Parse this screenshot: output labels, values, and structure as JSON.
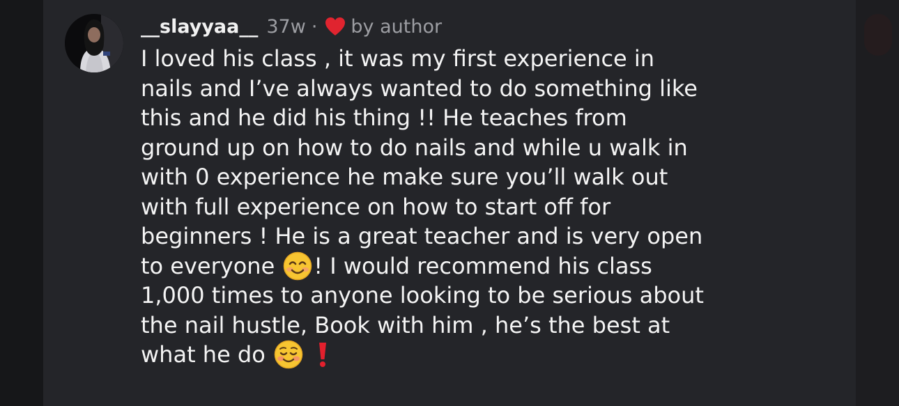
{
  "comment": {
    "username": "__slayyaa__",
    "timestamp": "37w",
    "separator": "·",
    "liked_by_author_icon": "heart-icon",
    "liked_by_author_label": "by author",
    "colors": {
      "heart": "#e0242f",
      "username": "#f2f2f2",
      "meta": "#9d9ea3",
      "background": "#242529"
    },
    "lines": [
      "I loved his class , it was my first experience in",
      "nails and I’ve always wanted to do something like",
      "this and he did his thing !! He teaches from",
      "ground up on how to do nails and while u walk in",
      "with 0 experience he make sure you’ll walk out",
      "with full experience on how to start off for",
      "beginners ! He is a great teacher and is very open"
    ],
    "line_8_before_emoji": "to everyone",
    "line_8_emoji": "smiling-face-with-smiling-eyes-emoji",
    "line_8_after_emoji": "! I would recommend his class",
    "lines_after": [
      "1,000 times to anyone looking to be serious about",
      "the nail hustle, Book with him , he’s the best at"
    ],
    "last_line_text": "what he do",
    "last_line_emoji": "smiling-face-emoji",
    "last_line_mark": "red-exclamation-mark-icon"
  }
}
